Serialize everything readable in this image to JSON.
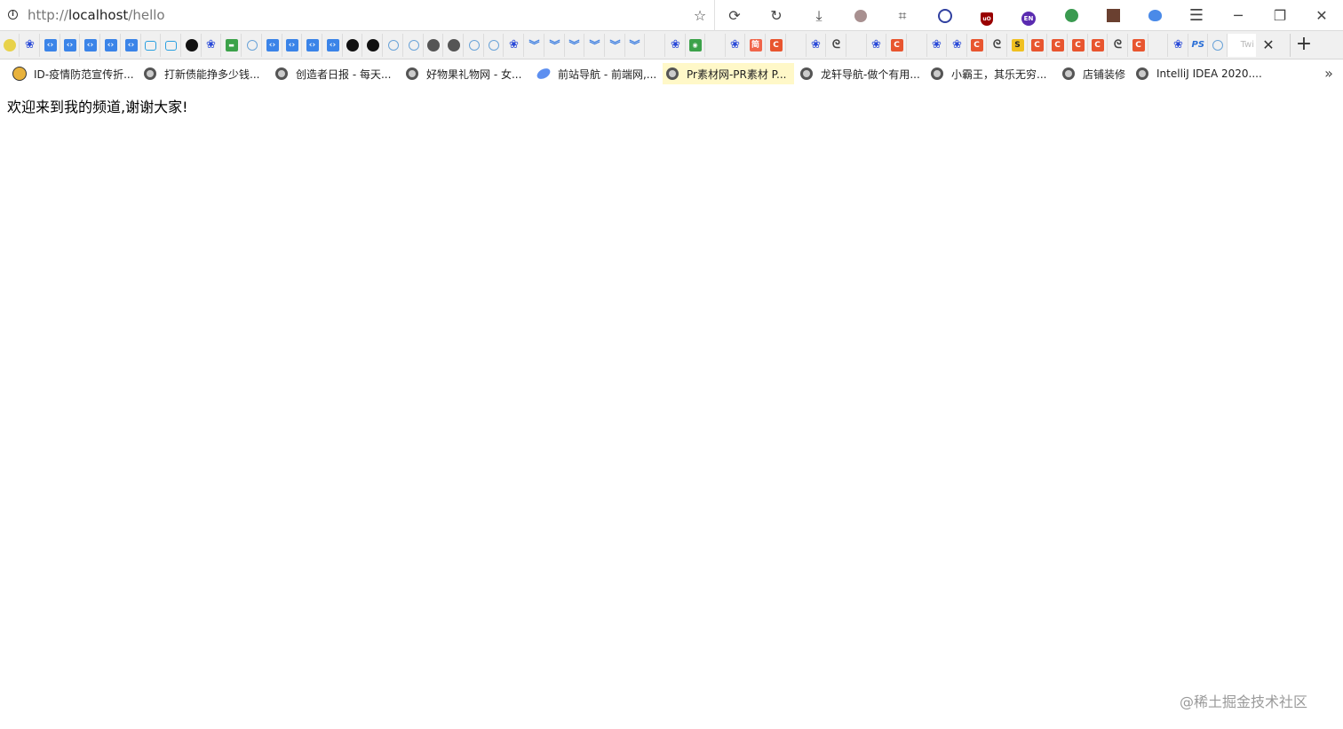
{
  "address_bar": {
    "protocol": "http://",
    "host": "localhost",
    "path": "/hello"
  },
  "toolbar_icons": [
    "bookmark-star-icon",
    "sync-icon",
    "undo-icon",
    "download-icon",
    "avatar-extension-icon",
    "crop-icon",
    "block-extension-icon",
    "ublock-icon",
    "translate-extension-icon",
    "globe-extension-icon",
    "profile-extension-icon",
    "cat-extension-icon",
    "menu-icon"
  ],
  "window_controls": {
    "minimize": "─",
    "restore": "❐",
    "close": "✕"
  },
  "tabs": {
    "active_partial_title": "Twi",
    "close_glyph": "✕",
    "new_tab_glyph": "+"
  },
  "bookmarks": [
    {
      "label": "ID-疫情防范宣传折...",
      "icon": "emoji-face-icon"
    },
    {
      "label": "打新债能挣多少钱...",
      "icon": "globe-icon"
    },
    {
      "label": "创造者日报 - 每天...",
      "icon": "globe-icon"
    },
    {
      "label": "好物果礼物网 - 女...",
      "icon": "globe-icon"
    },
    {
      "label": "前站导航 - 前端网,...",
      "icon": "planet-icon"
    },
    {
      "label": "Pr素材网-PR素材 P...",
      "icon": "globe-icon"
    },
    {
      "label": "龙轩导航-做个有用...",
      "icon": "globe-icon"
    },
    {
      "label": "小霸王，其乐无穷...",
      "icon": "globe-icon"
    },
    {
      "label": "店铺装修",
      "icon": "globe-icon"
    },
    {
      "label": "IntelliJ IDEA 2020....",
      "icon": "globe-icon"
    }
  ],
  "bookmarks_overflow": "»",
  "page": {
    "body_text": "欢迎来到我的频道,谢谢大家!"
  },
  "watermark": "@稀土掘金技术社区",
  "colors": {
    "accent_blue": "#3b84e8",
    "highlight_bookmark": "#fff8c8",
    "orange_favicon": "#e8552f"
  }
}
